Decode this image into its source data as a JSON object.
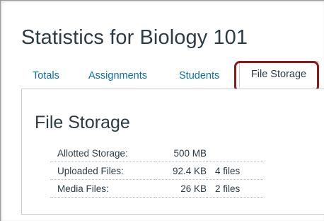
{
  "page": {
    "title": "Statistics for Biology 101"
  },
  "tabs": [
    {
      "label": "Totals",
      "active": false
    },
    {
      "label": "Assignments",
      "active": false
    },
    {
      "label": "Students",
      "active": false
    },
    {
      "label": "File Storage",
      "active": true
    }
  ],
  "panel": {
    "title": "File Storage",
    "rows": [
      {
        "label": "Allotted Storage:",
        "size": "500 MB",
        "files": ""
      },
      {
        "label": "Uploaded Files:",
        "size": "92.4 KB",
        "files": "4 files"
      },
      {
        "label": "Media Files:",
        "size": "26 KB",
        "files": "2 files"
      }
    ]
  },
  "colors": {
    "link": "#0770a3",
    "text": "#2d3b45",
    "highlight": "#8b1b1b"
  }
}
